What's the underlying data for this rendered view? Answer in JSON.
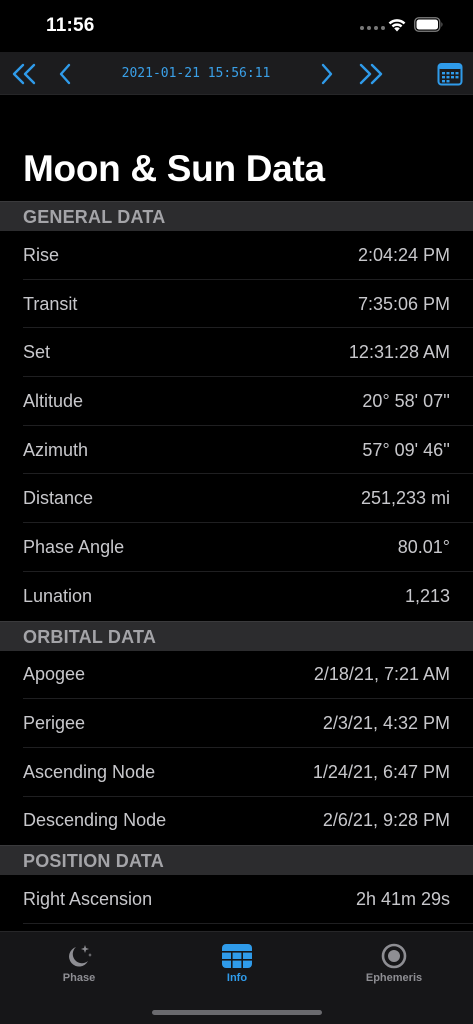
{
  "status": {
    "time": "11:56"
  },
  "toolbar": {
    "date": "2021-01-21 15:56:11",
    "icons": [
      "double-chevron-left-icon",
      "chevron-left-icon",
      "chevron-right-icon",
      "double-chevron-right-icon",
      "calendar-icon"
    ]
  },
  "page": {
    "title": "Moon & Sun Data"
  },
  "sections": {
    "general": {
      "title": "GENERAL DATA",
      "rows": [
        {
          "label": "Rise",
          "value": "2:04:24 PM"
        },
        {
          "label": "Transit",
          "value": "7:35:06 PM"
        },
        {
          "label": "Set",
          "value": "12:31:28 AM"
        },
        {
          "label": "Altitude",
          "value": "20° 58' 07''"
        },
        {
          "label": "Azimuth",
          "value": "57° 09' 46''"
        },
        {
          "label": "Distance",
          "value": "251,233 mi"
        },
        {
          "label": "Phase Angle",
          "value": "80.01°"
        },
        {
          "label": "Lunation",
          "value": "1,213"
        }
      ]
    },
    "orbital": {
      "title": "ORBITAL DATA",
      "rows": [
        {
          "label": "Apogee",
          "value": "2/18/21, 7:21 AM"
        },
        {
          "label": "Perigee",
          "value": "2/3/21, 4:32 PM"
        },
        {
          "label": "Ascending Node",
          "value": "1/24/21, 6:47 PM"
        },
        {
          "label": "Descending Node",
          "value": "2/6/21, 9:28 PM"
        }
      ]
    },
    "position": {
      "title": "POSITION DATA",
      "rows": [
        {
          "label": "Right Ascension",
          "value": "2h 41m 29s"
        }
      ]
    }
  },
  "tabs": [
    {
      "label": "Phase",
      "icon": "moon-stars-icon",
      "active": false
    },
    {
      "label": "Info",
      "icon": "table-icon",
      "active": true
    },
    {
      "label": "Ephemeris",
      "icon": "target-icon",
      "active": false
    }
  ],
  "colors": {
    "accent": "#2f9bea",
    "background": "#000000",
    "section": "#2c2c2e"
  }
}
